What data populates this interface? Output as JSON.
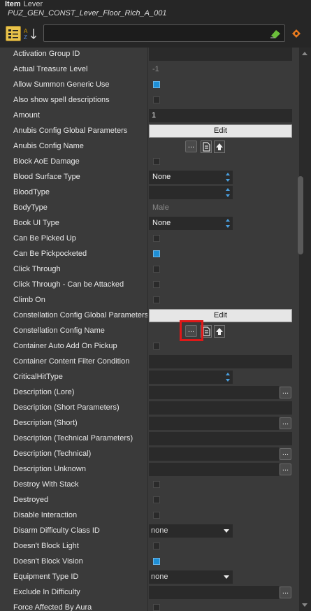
{
  "header": {
    "kind": "Item",
    "type": "Lever",
    "name": "PUZ_GEN_CONST_Lever_Floor_Rich_A_001"
  },
  "toolbar": {
    "filter_placeholder": "",
    "categorize_icon": "categorize-icon",
    "sort_icon": "alpha-sort-icon",
    "filter_icon": "eraser-icon",
    "pin_icon": "pin-icon"
  },
  "colors": {
    "background": "#262626",
    "grid": "#3a3a3a",
    "checked": "#1e8fd6",
    "edit_button": "#e6e6e6",
    "highlight": "#e01818"
  },
  "rows": [
    {
      "label": "Activation Group ID",
      "kind": "empty"
    },
    {
      "label": "Actual Treasure Level",
      "kind": "readonly",
      "value": "-1"
    },
    {
      "label": "Allow Summon Generic Use",
      "kind": "checkbox",
      "checked": true
    },
    {
      "label": "Also show spell descriptions",
      "kind": "checkbox",
      "checked": false
    },
    {
      "label": "Amount",
      "kind": "text",
      "value": "1"
    },
    {
      "label": "Anubis Config Global Parameters",
      "kind": "edit",
      "value": "Edit"
    },
    {
      "label": "Anubis Config Name",
      "kind": "resource"
    },
    {
      "label": "Block AoE Damage",
      "kind": "checkbox",
      "checked": false
    },
    {
      "label": "Blood Surface Type",
      "kind": "spin",
      "value": "None"
    },
    {
      "label": "BloodType",
      "kind": "spin",
      "value": ""
    },
    {
      "label": "BodyType",
      "kind": "readonly",
      "value": "Male"
    },
    {
      "label": "Book UI Type",
      "kind": "spin",
      "value": "None"
    },
    {
      "label": "Can Be Picked Up",
      "kind": "checkbox",
      "checked": false
    },
    {
      "label": "Can Be Pickpocketed",
      "kind": "checkbox",
      "checked": true
    },
    {
      "label": "Click Through",
      "kind": "checkbox",
      "checked": false
    },
    {
      "label": "Click Through - Can be Attacked",
      "kind": "checkbox",
      "checked": false
    },
    {
      "label": "Climb On",
      "kind": "checkbox",
      "checked": false
    },
    {
      "label": "Constellation Config Global Parameters",
      "kind": "edit",
      "value": "Edit"
    },
    {
      "label": "Constellation Config Name",
      "kind": "resource",
      "highlighted": true
    },
    {
      "label": "Container Auto Add On Pickup",
      "kind": "checkbox",
      "checked": false
    },
    {
      "label": "Container Content Filter Condition",
      "kind": "empty"
    },
    {
      "label": "CriticalHitType",
      "kind": "spin",
      "value": ""
    },
    {
      "label": "Description (Lore)",
      "kind": "longtext"
    },
    {
      "label": "Description (Short Parameters)",
      "kind": "empty"
    },
    {
      "label": "Description (Short)",
      "kind": "longtext"
    },
    {
      "label": "Description (Technical Parameters)",
      "kind": "empty"
    },
    {
      "label": "Description (Technical)",
      "kind": "longtext"
    },
    {
      "label": "Description Unknown",
      "kind": "longtext"
    },
    {
      "label": "Destroy With Stack",
      "kind": "checkbox",
      "checked": false
    },
    {
      "label": "Destroyed",
      "kind": "checkbox",
      "checked": false
    },
    {
      "label": "Disable Interaction",
      "kind": "checkbox",
      "checked": false
    },
    {
      "label": "Disarm Difficulty Class ID",
      "kind": "dropdown",
      "value": "none"
    },
    {
      "label": "Doesn't Block Light",
      "kind": "checkbox",
      "checked": false
    },
    {
      "label": "Doesn't Block Vision",
      "kind": "checkbox",
      "checked": true
    },
    {
      "label": "Equipment Type ID",
      "kind": "dropdown",
      "value": "none"
    },
    {
      "label": "Exclude In Difficulty",
      "kind": "longtext"
    },
    {
      "label": "Force Affected By Aura",
      "kind": "checkbox",
      "checked": false
    }
  ],
  "buttons": {
    "dots": "..."
  }
}
